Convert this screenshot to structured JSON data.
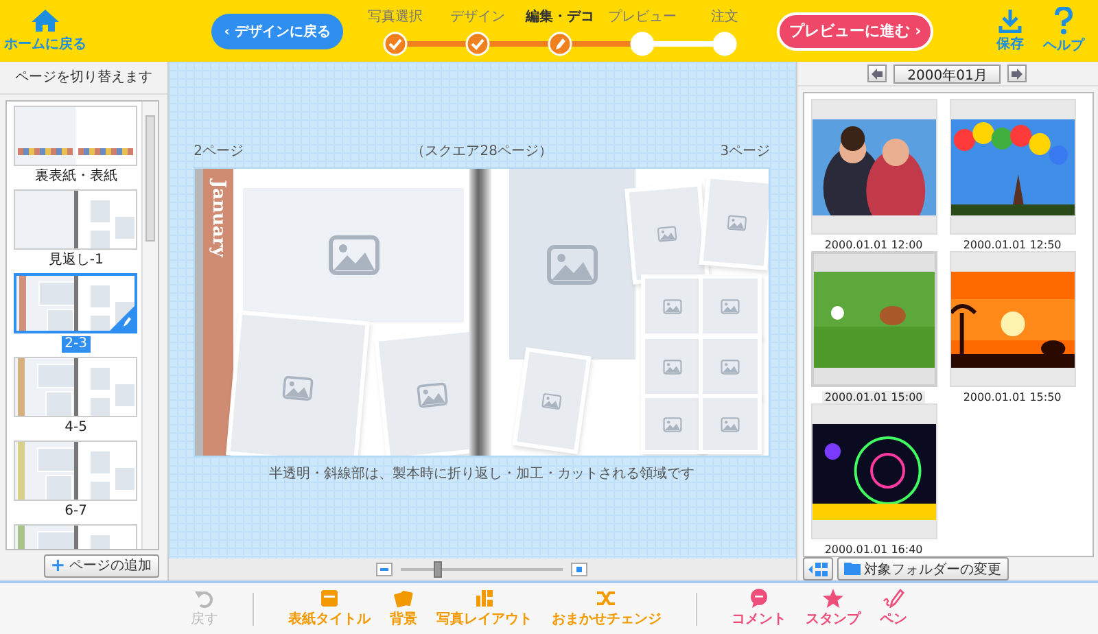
{
  "header": {
    "home": "ホームに戻る",
    "back_arrow": "‹",
    "back": "デザインに戻る",
    "next": "プレビューに進む",
    "next_arrow": "›",
    "save": "保存",
    "help": "ヘルプ",
    "steps": [
      {
        "label": "写真選択",
        "done": true,
        "selected": false
      },
      {
        "label": "デザイン",
        "done": true,
        "selected": false
      },
      {
        "label": "編集・デコ",
        "done": false,
        "selected": true
      },
      {
        "label": "プレビュー",
        "done": false,
        "selected": false
      },
      {
        "label": "注文",
        "done": false,
        "selected": false
      }
    ]
  },
  "page_list": {
    "title": "ページを切り替えます",
    "add_icon": "+",
    "add_button": "ページの追加",
    "items": [
      {
        "label": "裏表紙・表紙",
        "kind": "cover",
        "selected": false
      },
      {
        "label": "見返し-1",
        "kind": "endpaper",
        "selected": false
      },
      {
        "label": "2-3",
        "kind": "spread",
        "color": "#d0907a",
        "selected": true
      },
      {
        "label": "4-5",
        "kind": "spread",
        "color": "#d6b07e",
        "selected": false
      },
      {
        "label": "6-7",
        "kind": "spread",
        "color": "#d9d08a",
        "selected": false
      },
      {
        "kind": "spread",
        "color": "#a8c48a",
        "selected": false
      }
    ]
  },
  "editor": {
    "left_page": "2ページ",
    "book_type": "（スクエア28ページ）",
    "right_page": "3ページ",
    "month_title": "January",
    "note": "半透明・斜線部は、製本時に折り返し・加工・カットされる領域です",
    "zoom": {
      "level": 0.2
    }
  },
  "photos": {
    "month": "2000年01月",
    "change_folder": "対象フォルダーの変更",
    "items": [
      {
        "date": "2000.01.01  12:00",
        "selected": false
      },
      {
        "date": "2000.01.01  12:50",
        "selected": false
      },
      {
        "date": "2000.01.01  15:00",
        "selected": true
      },
      {
        "date": "2000.01.01  15:50",
        "selected": false
      },
      {
        "date": "2000.01.01  16:40",
        "selected": false
      }
    ]
  },
  "toolbar": [
    {
      "label": "戻す",
      "kind": "undo",
      "color": "#b8b8b8",
      "disabled": true
    },
    {
      "label": "表紙タイトル",
      "kind": "title",
      "color": "#f29a00",
      "disabled": false
    },
    {
      "label": "背景",
      "kind": "background",
      "color": "#f29a00",
      "disabled": false
    },
    {
      "label": "写真レイアウト",
      "kind": "layout",
      "color": "#f29a00",
      "disabled": false
    },
    {
      "label": "おまかせチェンジ",
      "kind": "shuffle",
      "color": "#f29a00",
      "disabled": false
    },
    {
      "label": "コメント",
      "kind": "comment",
      "color": "#ee4f7a",
      "disabled": false
    },
    {
      "label": "スタンプ",
      "kind": "stamp",
      "color": "#ee4f7a",
      "disabled": false
    },
    {
      "label": "ペン",
      "kind": "pen",
      "color": "#ee4f7a",
      "disabled": false
    }
  ]
}
